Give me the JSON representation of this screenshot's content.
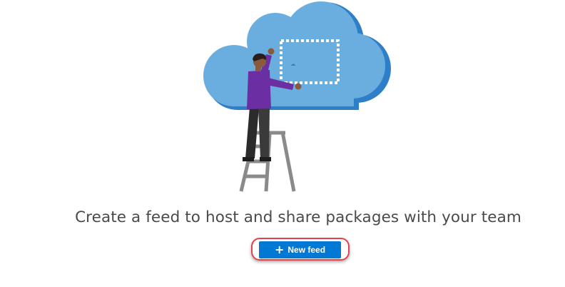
{
  "empty_state": {
    "headline": "Create a feed to host and share packages with your team",
    "illustration_icon": "cloud-with-person-on-ladder",
    "new_feed_button": {
      "icon": "plus-icon",
      "label": "New feed"
    }
  },
  "colors": {
    "cloud": "#6aaee0",
    "cloud_shadow": "#2f7fc8",
    "button": "#0078d4",
    "highlight": "#e0424e",
    "text": "#4a4a4a"
  }
}
